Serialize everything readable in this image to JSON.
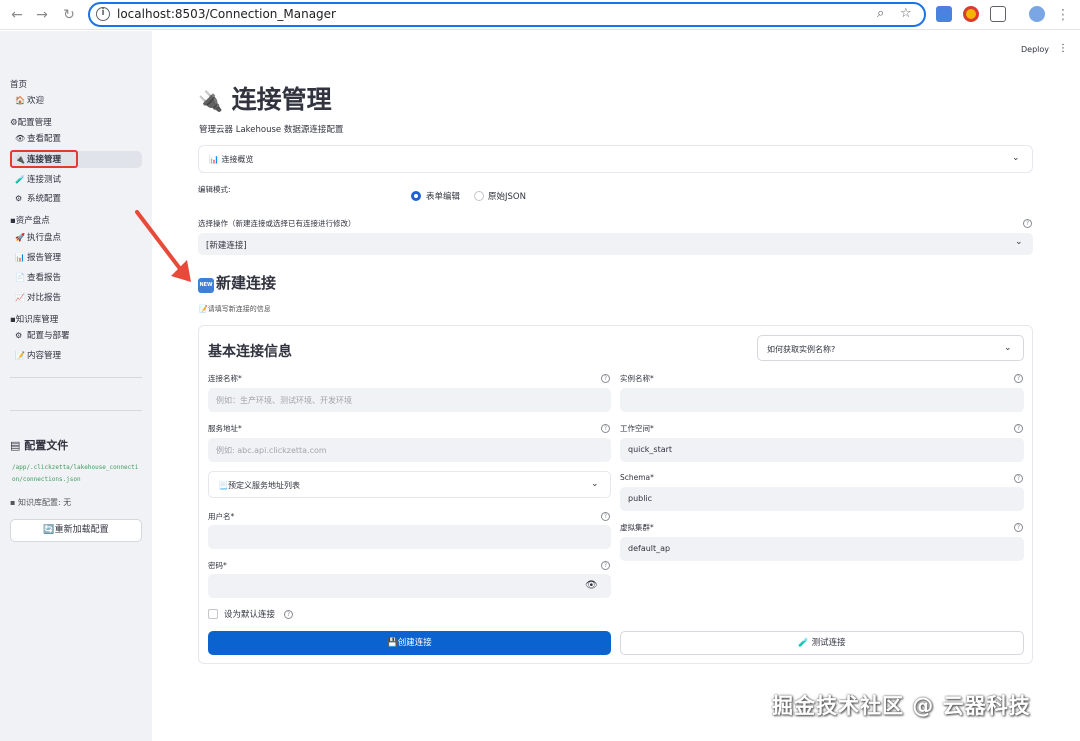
{
  "browser": {
    "url": "localhost:8503/Connection_Manager"
  },
  "sidebar": {
    "sections": [
      {
        "label": "首页"
      },
      {
        "label": "⚙配置管理"
      },
      {
        "label": "资产盘点"
      },
      {
        "label": "知识库管理"
      }
    ],
    "items": [
      {
        "icon": "🏠",
        "label": "欢迎"
      },
      {
        "icon": "👁",
        "label": "查看配置"
      },
      {
        "icon": "🔌",
        "label": "连接管理"
      },
      {
        "icon": "🧪",
        "label": "连接测试"
      },
      {
        "icon": "⚙",
        "label": "系统配置"
      },
      {
        "icon": "🚀",
        "label": "执行盘点"
      },
      {
        "icon": "📊",
        "label": "报告管理"
      },
      {
        "icon": "📄",
        "label": "查看报告"
      },
      {
        "icon": "📈",
        "label": "对比报告"
      },
      {
        "icon": "⚙",
        "label": "配置与部署"
      },
      {
        "icon": "📝",
        "label": "内容管理"
      }
    ],
    "config_file_title": "配置文件",
    "config_path": "/app/.clickzetta/lakehouse_connection/connections.json",
    "kb_config": "知识库配置: 无",
    "reload_button": "🔄重新加载配置"
  },
  "header": {
    "deploy": "Deploy",
    "menu": "⋮"
  },
  "main": {
    "title": "连接管理",
    "subtitle": "管理云器 Lakehouse 数据源连接配置",
    "overview_expander": "📊 连接概览",
    "edit_mode_label": "编辑模式:",
    "edit_modes": [
      "表单编辑",
      "原始JSON"
    ],
    "select_op_label": "选择操作（新建连接或选择已有连接进行修改）",
    "select_op_value": "[新建连接]",
    "new_connection_title": "新建连接",
    "new_badge": "NEW",
    "new_connection_caption": "📝请填写新连接的信息",
    "form": {
      "section_title": "基本连接信息",
      "instance_help_select": "如何获取实例名称?",
      "fields": {
        "connection_name": {
          "label": "连接名称*",
          "placeholder": "例如：生产环境、测试环境、开发环境"
        },
        "instance_name": {
          "label": "实例名称*",
          "value": ""
        },
        "service_address": {
          "label": "服务地址*",
          "placeholder": "例如: abc.api.clickzetta.com"
        },
        "workspace": {
          "label": "工作空间*",
          "value": "quick_start"
        },
        "predefined_services": "📃预定义服务地址列表",
        "schema": {
          "label": "Schema*",
          "value": "public"
        },
        "username": {
          "label": "用户名*",
          "value": ""
        },
        "virtual_cluster": {
          "label": "虚拟集群*",
          "value": "default_ap"
        },
        "password": {
          "label": "密码*",
          "value": ""
        }
      },
      "default_checkbox": "设为默认连接",
      "create_button": "💾创建连接",
      "test_button": "🧪 测试连接"
    }
  },
  "watermark": "掘金技术社区 @ 云器科技"
}
